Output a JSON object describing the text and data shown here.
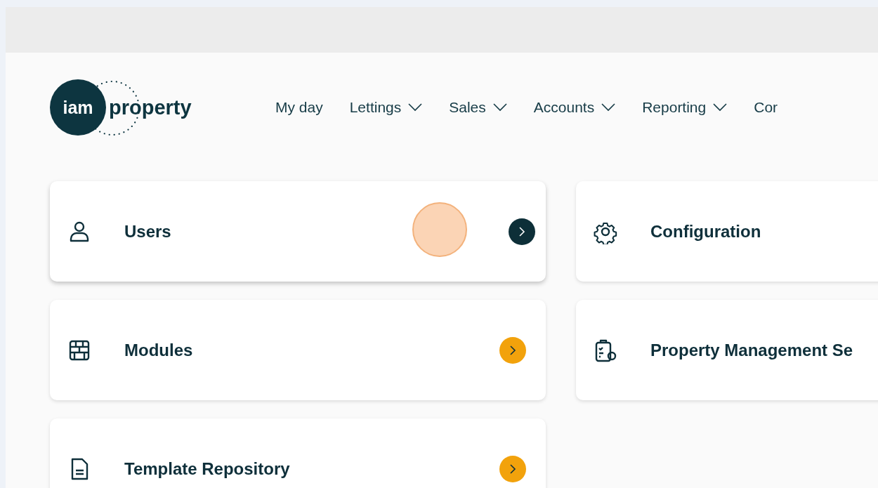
{
  "logo": {
    "mark": "iam",
    "word": "property"
  },
  "nav": [
    {
      "label": "My day",
      "has_caret": false
    },
    {
      "label": "Lettings",
      "has_caret": true
    },
    {
      "label": "Sales",
      "has_caret": true
    },
    {
      "label": "Accounts",
      "has_caret": true
    },
    {
      "label": "Reporting",
      "has_caret": true
    },
    {
      "label": "Cor",
      "has_caret": false
    }
  ],
  "cards": [
    {
      "title": "Users",
      "has_arrow": true,
      "highlighted": true
    },
    {
      "title": "Configuration",
      "highlighted": false
    },
    {
      "title": "Modules",
      "has_arrow": true,
      "highlighted": false
    },
    {
      "title": "Property Management Se",
      "highlighted": false
    },
    {
      "title": "Template Repository",
      "has_arrow": true,
      "highlighted": false
    }
  ]
}
